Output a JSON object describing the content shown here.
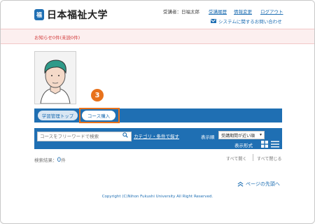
{
  "header": {
    "logo_mark": "福",
    "logo_text": "日本福祉大学",
    "user_label": "受講者：日福太郎",
    "nav": [
      "受講履歴",
      "情報変更",
      "ログアウト"
    ],
    "contact": "システムに関するお問い合わせ"
  },
  "notice": {
    "text": "お知らせ0件(未読0件)"
  },
  "step_badge": "3",
  "tabs": [
    "学習管理トップ",
    "コース購入"
  ],
  "search": {
    "placeholder": "コースをフリーワードで検索",
    "category_link": "カテゴリ・条件で探す",
    "sort_label": "表示順",
    "sort_value": "受講期間が近い順",
    "display_label": "表示形式"
  },
  "results": {
    "label": "検索結果：",
    "count": "0",
    "unit": "件"
  },
  "toggles": {
    "open_all": "すべて開く",
    "close_all": "すべて閉じる"
  },
  "pagetop": "ページの先頭へ",
  "copyright": "Copyright (C)Nihon Fukushi University All Right Reserved.",
  "colors": {
    "primary": "#1f6fb3",
    "accent": "#e8721c",
    "notice_text": "#d23a3a",
    "notice_bg": "#fcefef"
  },
  "icons": [
    "logo-icon",
    "mail-icon",
    "avatar-illustration",
    "search-icon",
    "grid-view-icon",
    "list-view-icon",
    "chevron-up-icon"
  ]
}
